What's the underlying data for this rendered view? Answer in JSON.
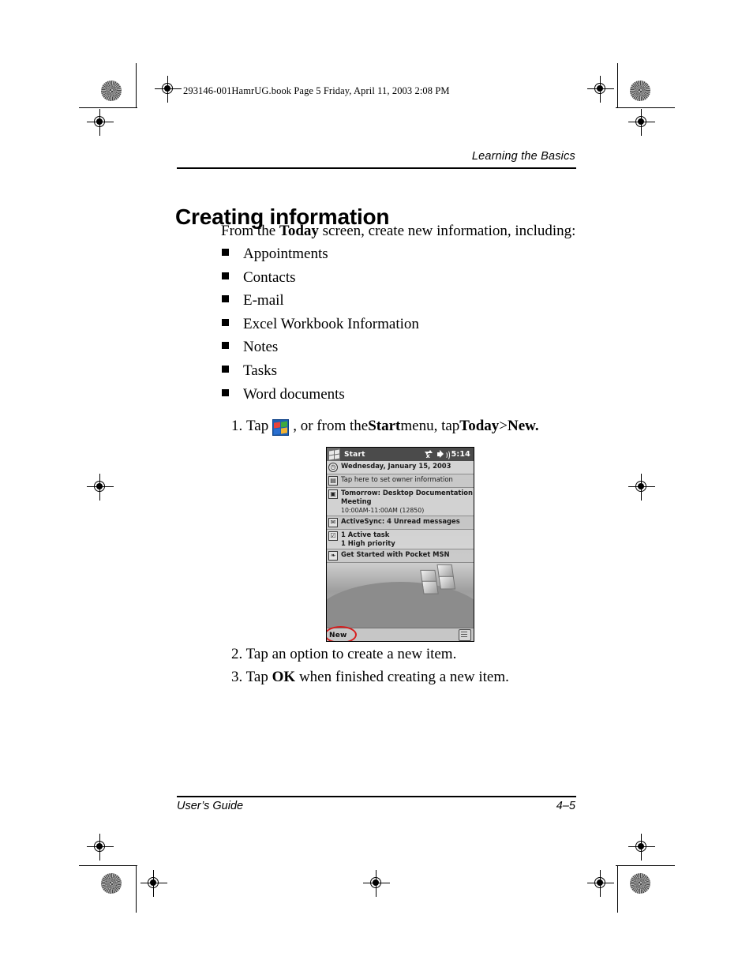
{
  "slug_line": "293146-001HamrUG.book  Page 5  Friday, April 11, 2003  2:08 PM",
  "header": {
    "running_head": "Learning the Basics"
  },
  "title": "Creating information",
  "intro": {
    "before": "From the ",
    "bold": "Today",
    "after": " screen, create new information, including:"
  },
  "bullets": [
    {
      "label": "Appointments"
    },
    {
      "label": "Contacts"
    },
    {
      "label": "E-mail"
    },
    {
      "label": "Excel Workbook Information"
    },
    {
      "label": "Notes"
    },
    {
      "label": "Tasks"
    },
    {
      "label": "Word documents"
    }
  ],
  "steps": {
    "step1": {
      "number": "1.",
      "text_before_icon": "Tap",
      "icon_name": "windows-start-logo-icon",
      "text_after_icon_a": ", or from the ",
      "bold_start": "Start",
      "text_after_icon_b": " menu, tap ",
      "bold_today": "Today",
      "separator": " > ",
      "bold_new": "New."
    },
    "step2": "2. Tap an option to create a new item.",
    "step3_prefix": "3. Tap ",
    "step3_bold": "OK",
    "step3_suffix": " when finished creating a new item."
  },
  "pda_screenshot": {
    "titlebar": {
      "start_label": "Start",
      "connectivity_icon": "connection-off-icon",
      "volume_icon": "speaker-icon",
      "time": "5:14"
    },
    "rows": [
      {
        "icon": "clock-icon",
        "line1": "Wednesday, January 15, 2003",
        "bold": true
      },
      {
        "icon": "owner-info-icon",
        "line1": "Tap here to set owner information",
        "bold": false
      },
      {
        "icon": "calendar-icon",
        "line1": "Tomorrow: Desktop Documentation",
        "line2": "Meeting",
        "line3": "10:00AM-11:00AM (12850)",
        "bold": true
      },
      {
        "icon": "activesync-icon",
        "line1": "ActiveSync: 4 Unread messages",
        "bold": true
      },
      {
        "icon": "tasks-icon",
        "line1": "1 Active task",
        "line2": "1 High priority",
        "bold": true
      },
      {
        "icon": "pocket-msn-icon",
        "line1": "Get Started with Pocket MSN",
        "bold": true
      }
    ],
    "command_bar": {
      "new_button": "New",
      "sip_icon": "input-panel-icon"
    },
    "annotation": {
      "shape": "red-ellipse",
      "color": "#d81c1c",
      "targets": "New"
    }
  },
  "footer": {
    "left": "User’s Guide",
    "page_number": "4–5"
  }
}
